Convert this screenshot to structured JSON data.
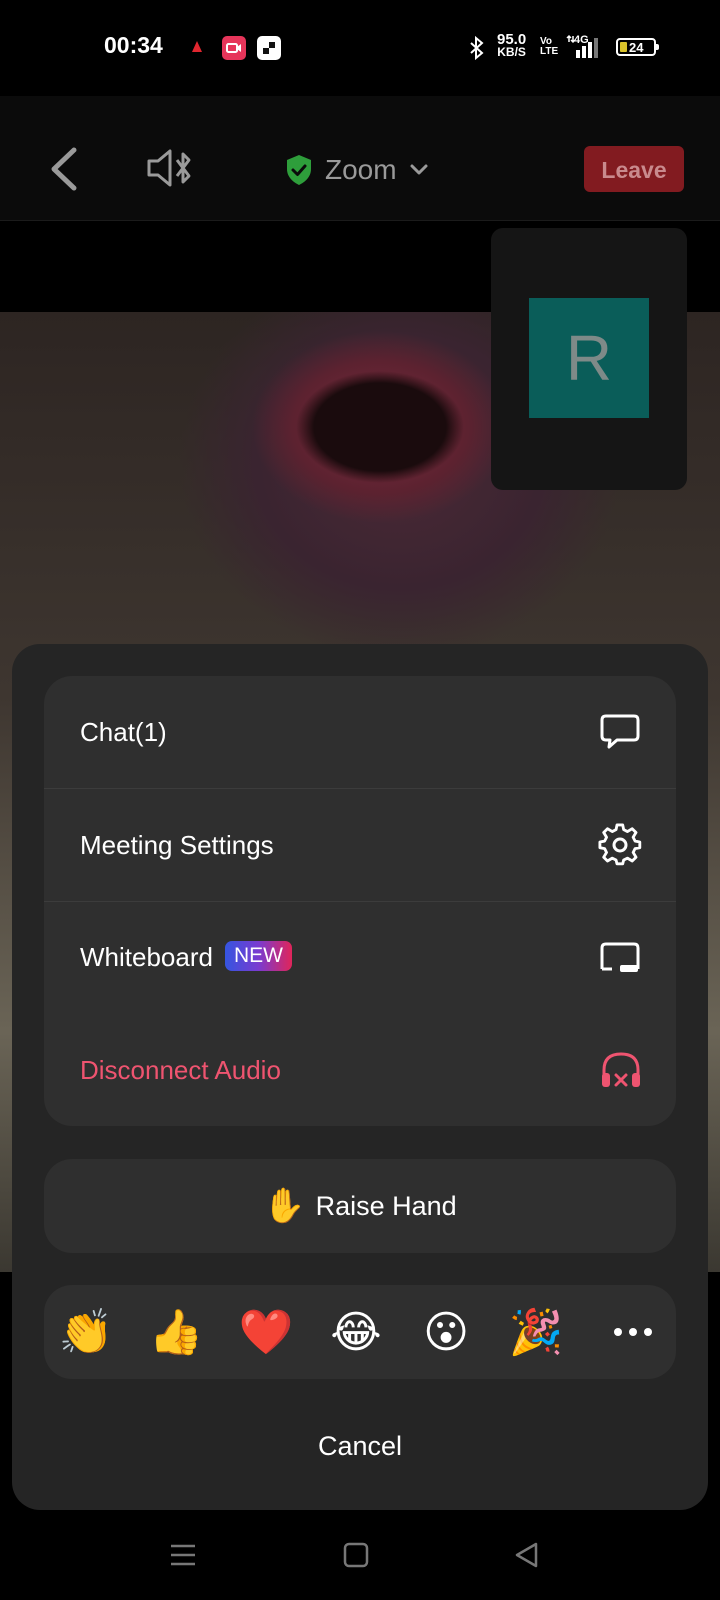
{
  "status_bar": {
    "time": "00:34",
    "net_speed_value": "95.0",
    "net_speed_unit": "KB/S",
    "volte_top": "Vo",
    "volte_bottom": "LTE",
    "network": "4G",
    "battery": "24",
    "icons": [
      "notification-icon",
      "screen-record-icon",
      "app-icon",
      "bluetooth-icon",
      "signal-icon",
      "battery-icon"
    ]
  },
  "header": {
    "title": "Zoom",
    "leave_label": "Leave",
    "icons": [
      "back-arrow-icon",
      "speaker-bluetooth-icon",
      "shield-check-icon",
      "chevron-down-icon"
    ],
    "leave_color": "#821b20",
    "shield_color": "#2e9e3b"
  },
  "participant": {
    "initial": "R",
    "avatar_color": "#0a5d59"
  },
  "menu": {
    "items": [
      {
        "label": "Chat(1)",
        "icon": "chat-bubble-icon"
      },
      {
        "label": "Meeting Settings",
        "icon": "gear-icon"
      },
      {
        "label": "Whiteboard",
        "badge": "NEW",
        "icon": "whiteboard-icon"
      },
      {
        "label": "Disconnect Audio",
        "icon": "headphones-off-icon",
        "color": "#ef5470"
      }
    ]
  },
  "raise_hand": {
    "emoji": "✋",
    "label": "Raise Hand"
  },
  "reactions": {
    "items": [
      "👏",
      "👍",
      "❤️",
      "😂",
      "😮",
      "🎉"
    ],
    "more_icon": "more-dots-icon"
  },
  "cancel_label": "Cancel",
  "nav_bar": {
    "icons": [
      "menu-icon",
      "home-square-icon",
      "back-triangle-icon"
    ]
  }
}
